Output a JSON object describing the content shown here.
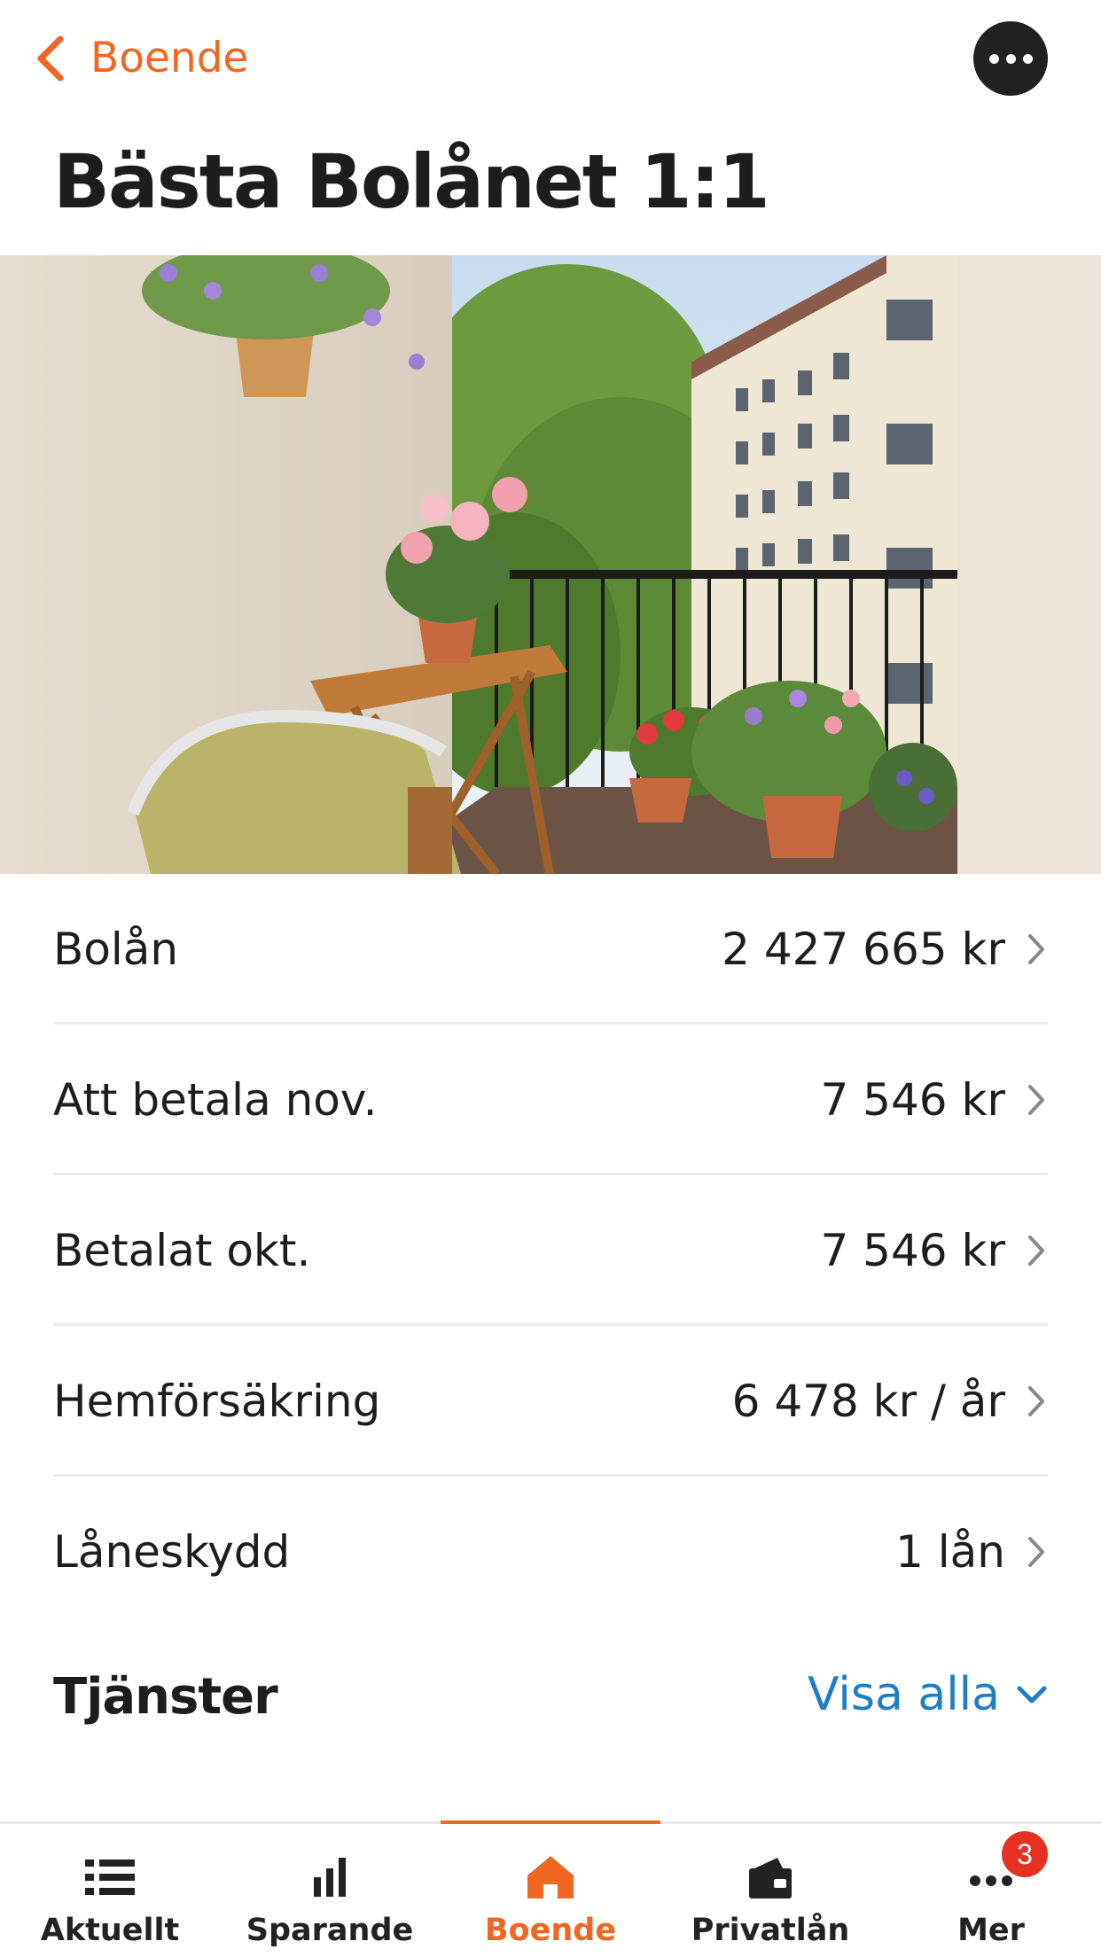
{
  "header": {
    "back_label": "Boende",
    "title": "Bästa Bolånet 1:1"
  },
  "colors": {
    "accent": "#f06623",
    "link": "#1d7ec7",
    "badge": "#e53224",
    "dark_button": "#222120"
  },
  "rows": [
    {
      "label": "Bolån",
      "value": "2 427 665 kr"
    },
    {
      "label": "Att betala nov.",
      "value": "7 546 kr"
    },
    {
      "label": "Betalat okt.",
      "value": "7 546 kr"
    },
    {
      "label": "Hemförsäkring",
      "value": "6 478 kr / år"
    },
    {
      "label": "Låneskydd",
      "value": "1 lån"
    }
  ],
  "services": {
    "title": "Tjänster",
    "show_all": "Visa alla"
  },
  "tabbar": {
    "tabs": [
      {
        "label": "Aktuellt",
        "icon": "list-icon"
      },
      {
        "label": "Sparande",
        "icon": "bar-chart-icon"
      },
      {
        "label": "Boende",
        "icon": "house-icon",
        "active": true
      },
      {
        "label": "Privatlån",
        "icon": "wallet-icon"
      },
      {
        "label": "Mer",
        "icon": "more-dots-icon"
      }
    ],
    "badge_count": "3"
  }
}
